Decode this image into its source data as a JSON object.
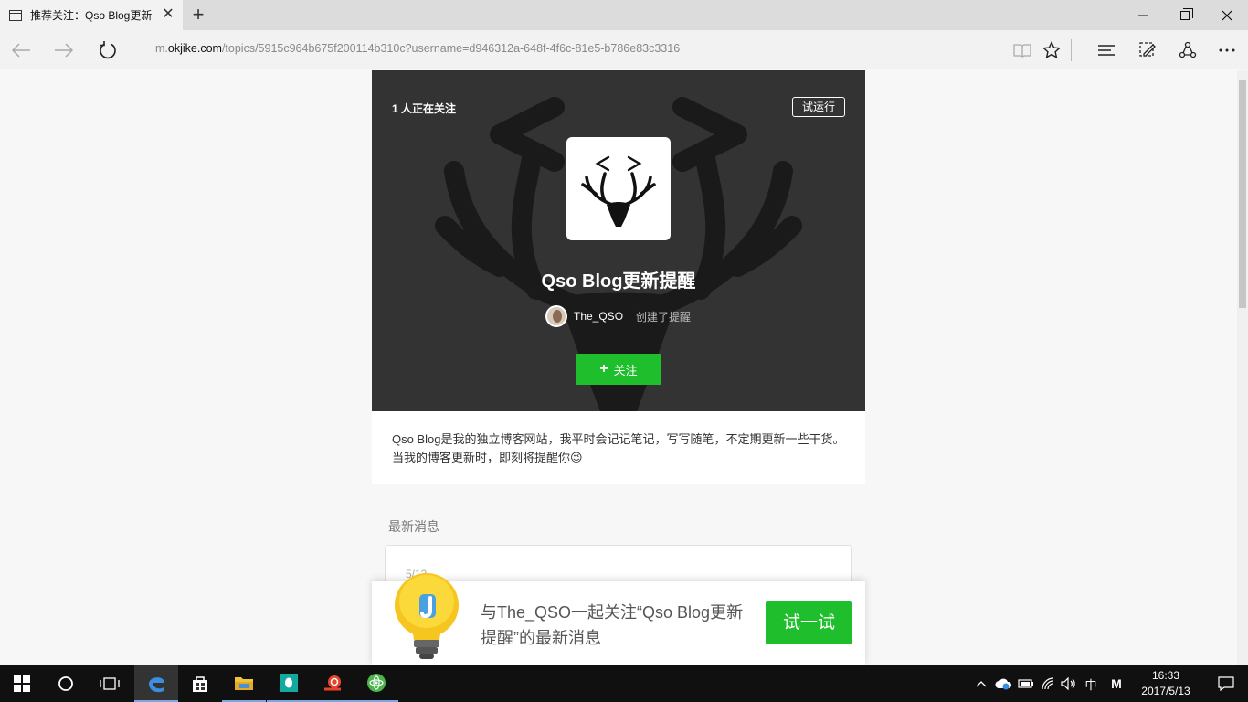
{
  "browser": {
    "tab_title": "推荐关注：Qso Blog更新",
    "tab_close": "✕",
    "new_tab": "+",
    "address_prefix": "m.",
    "address_host": "okjike.com",
    "address_path": "/topics/5915c964b675f200114b310c?username=d946312a-648f-4f6c-81e5-b786e83c3316"
  },
  "hero": {
    "followers": "1 人正在关注",
    "beta_label": "试运行",
    "title": "Qso Blog更新提醒",
    "creator_name": "The_QSO",
    "creator_action": "创建了提醒",
    "follow_plus": "+",
    "follow_label": "关注"
  },
  "description": "Qso Blog是我的独立博客网站，我平时会记记笔记，写写随笔，不定期更新一些干货。当我的博客更新时，即刻将提醒你😉",
  "latest": {
    "section_title": "最新消息",
    "first_date": "5/13"
  },
  "promo": {
    "text": "与The_QSO一起关注“Qso Blog更新提醒”的最新消息",
    "button": "试一试"
  },
  "taskbar": {
    "ime": "中",
    "ime_mode": "M",
    "time": "16:33",
    "date": "2017/5/13"
  },
  "colors": {
    "accent_green": "#1fbe2c",
    "hero_bg": "#333333"
  }
}
